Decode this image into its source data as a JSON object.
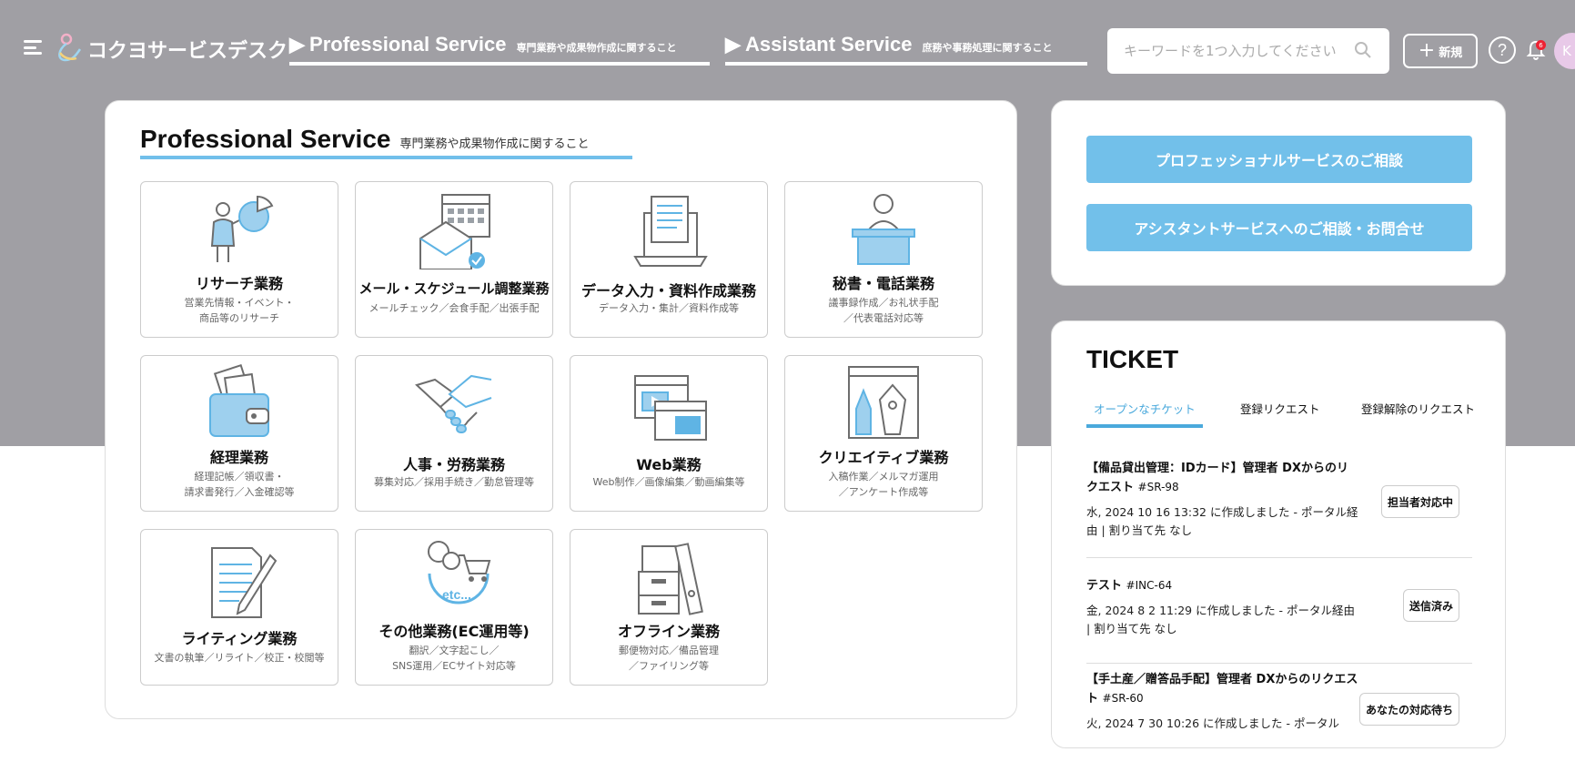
{
  "header": {
    "brand": "コクヨサービスデスク",
    "nav": [
      {
        "arrow": "▶",
        "main": "Professional Service",
        "sub": "専門業務や成果物作成に関すること"
      },
      {
        "arrow": "▶",
        "main": "Assistant Service",
        "sub": "庶務や事務処理に関すること"
      }
    ],
    "search_placeholder": "キーワードを1つ入力してください",
    "new_label": "新規",
    "help_label": "?",
    "notification_count": "6",
    "avatar_initial": "K"
  },
  "main": {
    "title": "Professional Service",
    "subtitle": "専門業務や成果物作成に関すること",
    "cards": [
      {
        "title": "リサーチ業務",
        "desc": "営業先情報・イベント・\n商品等のリサーチ",
        "icon": "research-icon"
      },
      {
        "title": "メール・スケジュール調整業務",
        "desc": "メールチェック／会食手配／出張手配",
        "icon": "mail-calendar-icon"
      },
      {
        "title": "データ入力・資料作成業務",
        "desc": "データ入力・集計／資料作成等",
        "icon": "laptop-document-icon"
      },
      {
        "title": "秘書・電話業務",
        "desc": "議事録作成／お礼状手配\n／代表電話対応等",
        "icon": "secretary-desk-icon"
      },
      {
        "title": "経理業務",
        "desc": "経理記帳／領収書・\n請求書発行／入金確認等",
        "icon": "wallet-icon"
      },
      {
        "title": "人事・労務業務",
        "desc": "募集対応／採用手続き／勤怠管理等",
        "icon": "handshake-icon"
      },
      {
        "title": "Web業務",
        "desc": "Web制作／画像編集／動画編集等",
        "icon": "web-windows-icon"
      },
      {
        "title": "クリエイティブ業務",
        "desc": "入稿作業／メルマガ運用\n／アンケート作成等",
        "icon": "pen-tools-icon"
      },
      {
        "title": "ライティング業務",
        "desc": "文書の執筆／リライト／校正・校閲等",
        "icon": "writing-icon"
      },
      {
        "title": "その他業務(EC運用等)",
        "desc": "翻訳／文字起こし／\nSNS運用／ECサイト対応等",
        "icon": "etc-cart-icon"
      },
      {
        "title": "オフライン業務",
        "desc": "郵便物対応／備品管理\n／ファイリング等",
        "icon": "boxes-files-icon"
      }
    ]
  },
  "side": {
    "btn1": "プロフェッショナルサービスのご相談",
    "btn2": "アシスタントサービスへのご相談・お問合せ"
  },
  "ticket": {
    "title": "TICKET",
    "tabs": [
      "オープンなチケット",
      "登録リクエスト",
      "登録解除のリクエスト"
    ],
    "items": [
      {
        "title": "【備品貸出管理：IDカード】管理者 DXからのリクエスト",
        "id": "#SR-98",
        "meta": "水, 2024 10 16 13:32 に作成しました  - ポータル経由  |  割り当て先 なし",
        "status": "担当者対応中"
      },
      {
        "title": "テスト",
        "id": "#INC-64",
        "meta": "金, 2024 8 2 11:29 に作成しました  - ポータル経由  |  割り当て先 なし",
        "status": "送信済み"
      },
      {
        "title": "【手土産／贈答品手配】管理者 DXからのリクエスト",
        "id": "#SR-60",
        "meta": "火, 2024 7 30 10:26 に作成しました  - ポータル",
        "status": "あなたの対応待ち"
      }
    ]
  },
  "colors": {
    "accent": "#72c0ea",
    "header_bg": "#a09fa4",
    "icon_blue": "#5fb4e4",
    "icon_gray": "#6d6d6d"
  }
}
